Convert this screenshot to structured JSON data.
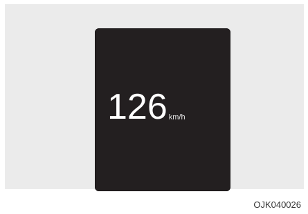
{
  "display": {
    "speed_value": "126",
    "speed_unit": "km/h"
  },
  "caption": {
    "figure_code": "OJK040026"
  }
}
